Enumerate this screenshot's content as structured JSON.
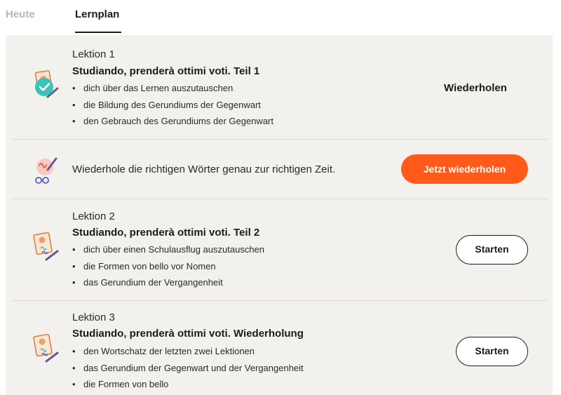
{
  "tabs": {
    "heute": "Heute",
    "lernplan": "Lernplan"
  },
  "lessons": [
    {
      "label": "Lektion 1",
      "title": "Studiando, prenderà ottimi voti. Teil 1",
      "bullets": [
        "dich über das Lernen auszutauschen",
        "die Bildung des Gerundiums der Gegenwart",
        "den Gebrauch des Gerundiums der Gegenwart"
      ],
      "action": "Wiederholen",
      "status": "completed"
    },
    {
      "label": "Lektion 2",
      "title": "Studiando, prenderà ottimi voti. Teil 2",
      "bullets": [
        "dich über einen Schulausflug auszutauschen",
        "die Formen von bello vor Nomen",
        "das Gerundium der Vergangenheit"
      ],
      "action": "Starten"
    },
    {
      "label": "Lektion 3",
      "title": "Studiando, prenderà ottimi voti. Wiederholung",
      "bullets": [
        "den Wortschatz der letzten zwei Lektionen",
        "das Gerundium der Gegenwart und der Vergangenheit",
        "die Formen von bello"
      ],
      "action": "Starten"
    }
  ],
  "review": {
    "text": "Wiederhole die richtigen Wörter genau zur richtigen Zeit.",
    "button": "Jetzt wiederholen"
  },
  "colors": {
    "accent": "#ff5a19",
    "panel_bg": "#f3f1ee",
    "check_teal": "#3cc3b9"
  },
  "icons": {
    "lesson_completed": "lesson-completed-icon",
    "review": "vocabulary-review-icon",
    "lesson": "lesson-writing-icon"
  }
}
